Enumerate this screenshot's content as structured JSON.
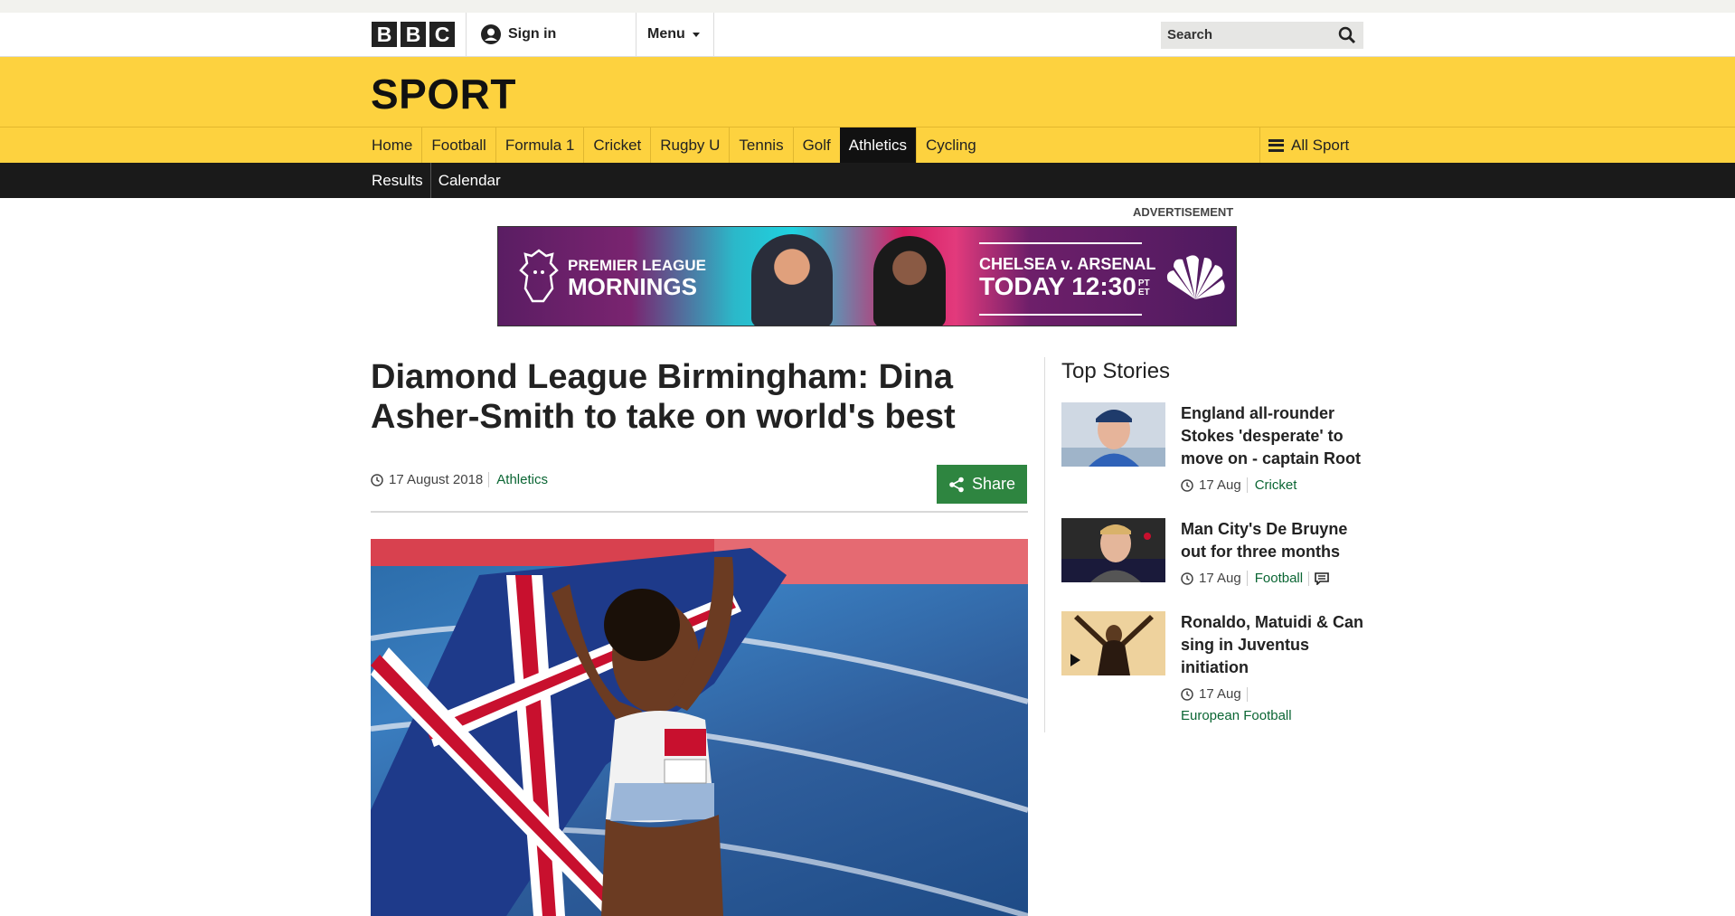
{
  "header": {
    "logo_letters": [
      "B",
      "B",
      "C"
    ],
    "signin_label": "Sign in",
    "menu_label": "Menu",
    "search_placeholder": "Search"
  },
  "section": {
    "title": "SPORT",
    "nav_items": [
      {
        "label": "Home"
      },
      {
        "label": "Football"
      },
      {
        "label": "Formula 1"
      },
      {
        "label": "Cricket"
      },
      {
        "label": "Rugby U"
      },
      {
        "label": "Tennis"
      },
      {
        "label": "Golf"
      },
      {
        "label": "Athletics",
        "active": true
      },
      {
        "label": "Cycling"
      }
    ],
    "all_sport_label": "All Sport",
    "subnav_items": [
      {
        "label": "Results"
      },
      {
        "label": "Calendar"
      }
    ]
  },
  "advertisement": {
    "label": "ADVERTISEMENT",
    "line1": "PREMIER LEAGUE",
    "line2": "MORNINGS",
    "match": "CHELSEA v. ARSENAL",
    "time": "TODAY 12:30",
    "time_suffix": "PT ET"
  },
  "article": {
    "headline": "Diamond League Birmingham: Dina Asher-Smith to take on world's best",
    "date": "17 August 2018",
    "category": "Athletics",
    "share_label": "Share"
  },
  "top_stories": {
    "heading": "Top Stories",
    "items": [
      {
        "title": "England all-rounder Stokes 'desperate' to move on - captain Root",
        "date": "17 Aug",
        "category": "Cricket"
      },
      {
        "title": "Man City's De Bruyne out for three months",
        "date": "17 Aug",
        "category": "Football",
        "has_comments": true
      },
      {
        "title": "Ronaldo, Matuidi & Can sing in Juventus initiation",
        "date": "17 Aug",
        "category": "European Football",
        "is_video": true
      }
    ]
  },
  "colors": {
    "sport_yellow": "#fdd23f",
    "nav_black": "#1a1a1a",
    "share_green": "#2e8540",
    "link_green": "#0b6634"
  }
}
